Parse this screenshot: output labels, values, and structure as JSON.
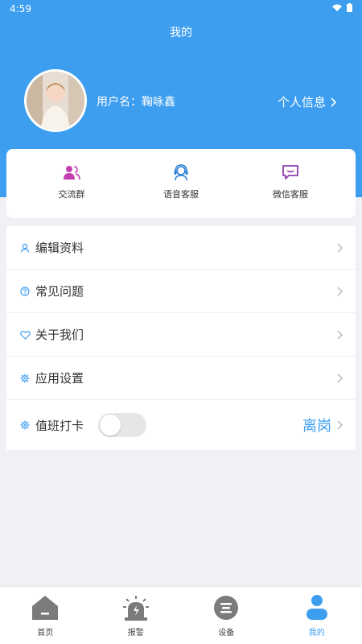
{
  "status_bar": {
    "time": "4:59"
  },
  "header": {
    "title": "我的",
    "username": "用户名：鞠咏鑫",
    "personal_info_label": "个人信息"
  },
  "quick_actions": [
    {
      "label": "交流群",
      "icon": "group-chat-icon",
      "color": "#c63fb0"
    },
    {
      "label": "语音客服",
      "icon": "voice-service-icon",
      "color": "#2a7fd6"
    },
    {
      "label": "微信客服",
      "icon": "wechat-service-icon",
      "color": "#8b3db0"
    }
  ],
  "menu": {
    "items": [
      {
        "label": "编辑资料",
        "icon": "user-icon"
      },
      {
        "label": "常见问题",
        "icon": "question-icon"
      },
      {
        "label": "关于我们",
        "icon": "heart-icon"
      },
      {
        "label": "应用设置",
        "icon": "settings-icon"
      }
    ],
    "duty": {
      "label": "值班打卡",
      "status": "离岗",
      "toggle_on": false
    }
  },
  "tabbar": {
    "tabs": [
      {
        "label": "首页",
        "icon": "home-icon",
        "active": false
      },
      {
        "label": "报警",
        "icon": "alarm-icon",
        "active": false
      },
      {
        "label": "设备",
        "icon": "device-icon",
        "active": false
      },
      {
        "label": "我的",
        "icon": "profile-icon",
        "active": true
      }
    ]
  },
  "colors": {
    "primary": "#3d9ef0",
    "background": "#f0f1f5"
  }
}
